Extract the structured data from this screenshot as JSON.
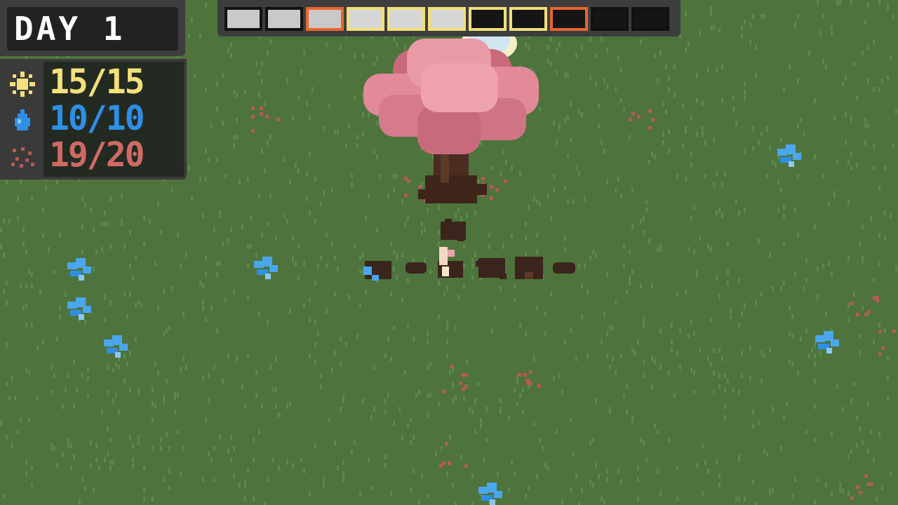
{
  "hud": {
    "day_label": "DAY 1",
    "stats": [
      {
        "icon": "sun-icon",
        "value": "15/15",
        "color": "#f3e07a"
      },
      {
        "icon": "water-drop-icon",
        "value": "10/10",
        "color": "#2f8fe6"
      },
      {
        "icon": "seeds-icon",
        "value": "19/20",
        "color": "#d06a64"
      }
    ],
    "time_slots": [
      {
        "fill": "#c9c9c9",
        "border": "#111111"
      },
      {
        "fill": "#c9c9c9",
        "border": "#111111"
      },
      {
        "fill": "#c9c9c9",
        "border": "#e8662e"
      },
      {
        "fill": "#d6d6d6",
        "border": "#efe07a"
      },
      {
        "fill": "#d6d6d6",
        "border": "#efe07a"
      },
      {
        "fill": "#d6d6d6",
        "border": "#efe07a"
      },
      {
        "fill": "#151515",
        "border": "#efe07a"
      },
      {
        "fill": "#151515",
        "border": "#efe07a"
      },
      {
        "fill": "#151515",
        "border": "#e8662e"
      },
      {
        "fill": "#151515",
        "border": "#111111"
      },
      {
        "fill": "#151515",
        "border": "#111111"
      }
    ]
  },
  "colors": {
    "grass": "#4e733d",
    "grass_blade": "#5c8a49",
    "blossom": "#e28a99",
    "blossom_dark": "#c96a7c",
    "trunk": "#4a2c20",
    "crystal": "#4aa6ee",
    "petals": "#b65a57"
  }
}
